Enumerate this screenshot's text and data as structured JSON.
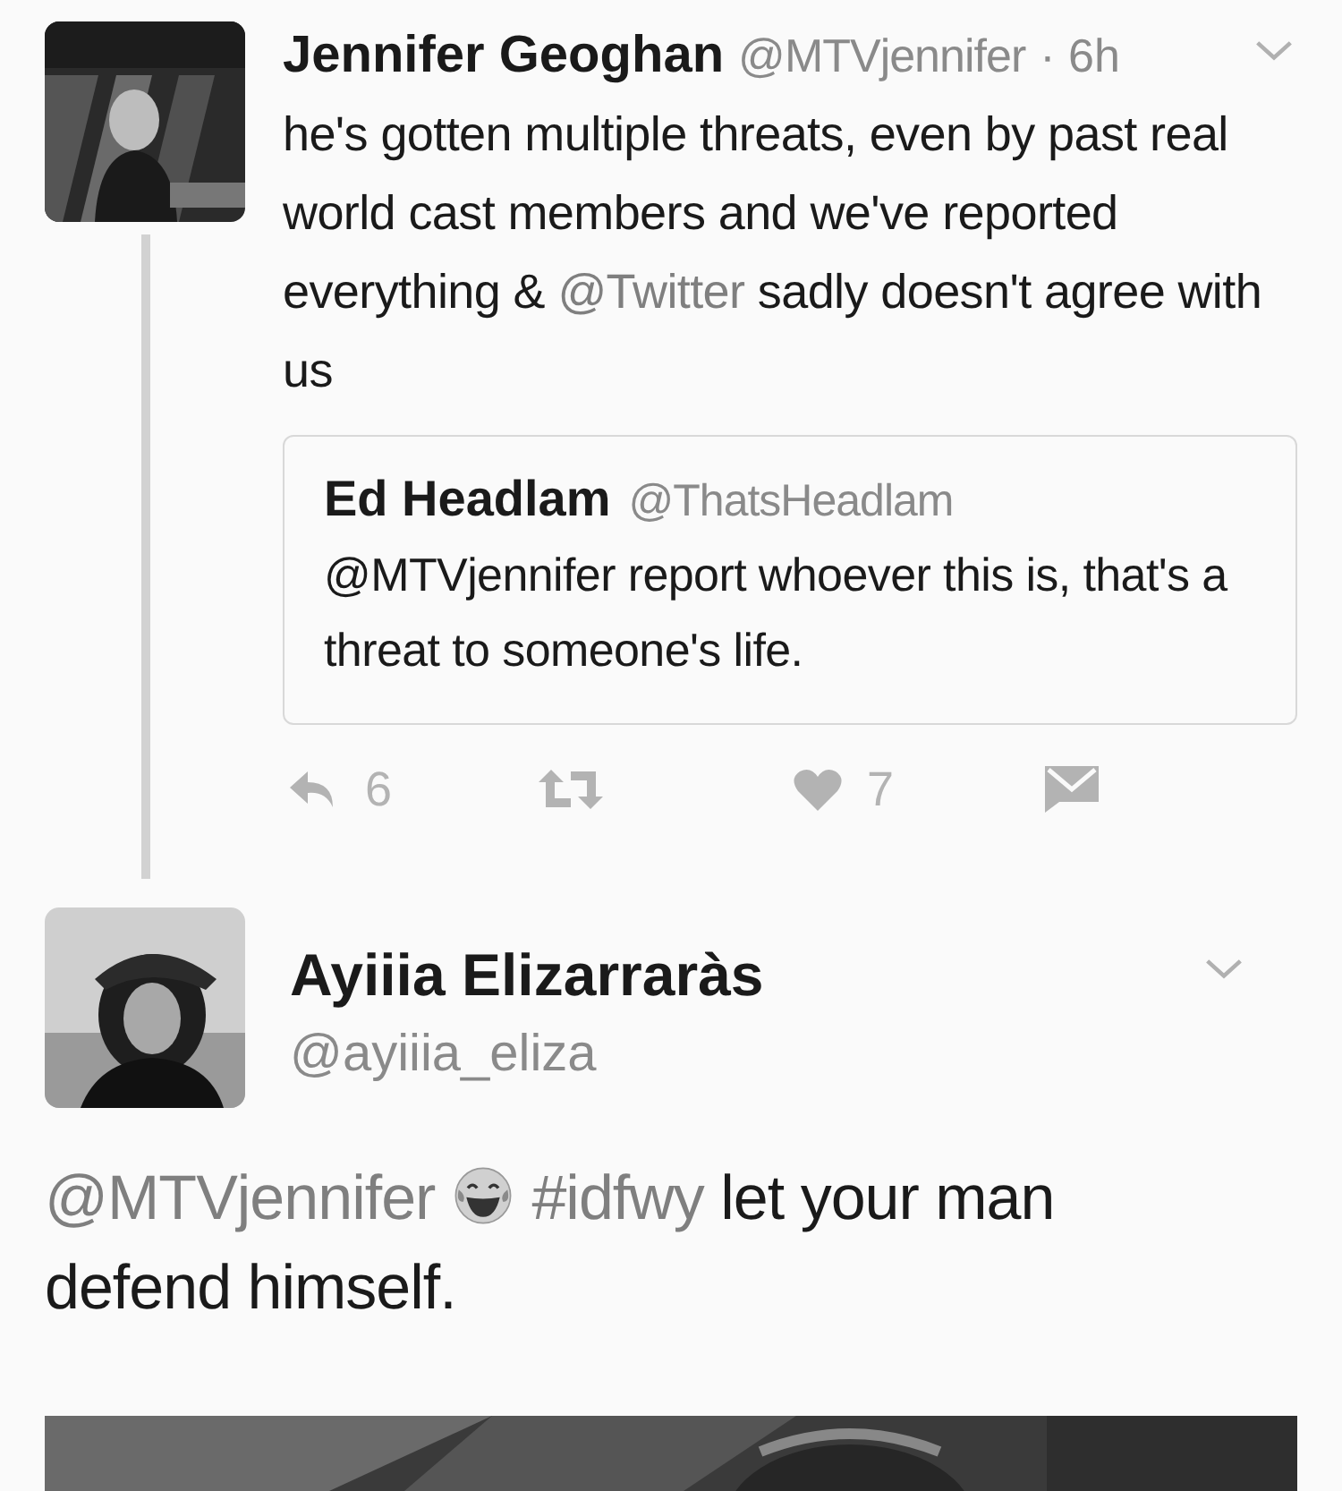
{
  "tweets": [
    {
      "name": "Jennifer Geoghan",
      "handle": "@MTVjennifer",
      "time": "· 6h",
      "kind": "threaded",
      "body": [
        {
          "kind": "text",
          "text": "he's gotten multiple threats, even by past real world cast members and we've reported everything & "
        },
        {
          "kind": "mention",
          "text": "@Twitter"
        },
        {
          "kind": "text",
          "text": " sadly doesn't agree with us"
        }
      ],
      "quote": {
        "name": "Ed Headlam",
        "handle": "@ThatsHeadlam",
        "text": "@MTVjennifer report whoever this is, that's a threat to someone's life."
      },
      "actions": [
        {
          "kind": "reply",
          "count": "6"
        },
        {
          "kind": "retweet"
        },
        {
          "kind": "like",
          "count": "7"
        },
        {
          "kind": "message"
        }
      ]
    },
    {
      "name": "Ayiiia Elizarraràs",
      "handle": "@ayiiia_eliza",
      "kind": "reply",
      "body": [
        {
          "kind": "mention",
          "text": "@MTVjennifer"
        },
        {
          "kind": "emoji"
        },
        {
          "kind": "mention",
          "text": "#idfwy"
        },
        {
          "kind": "text",
          "text": " let your man defend himself."
        }
      ]
    }
  ]
}
